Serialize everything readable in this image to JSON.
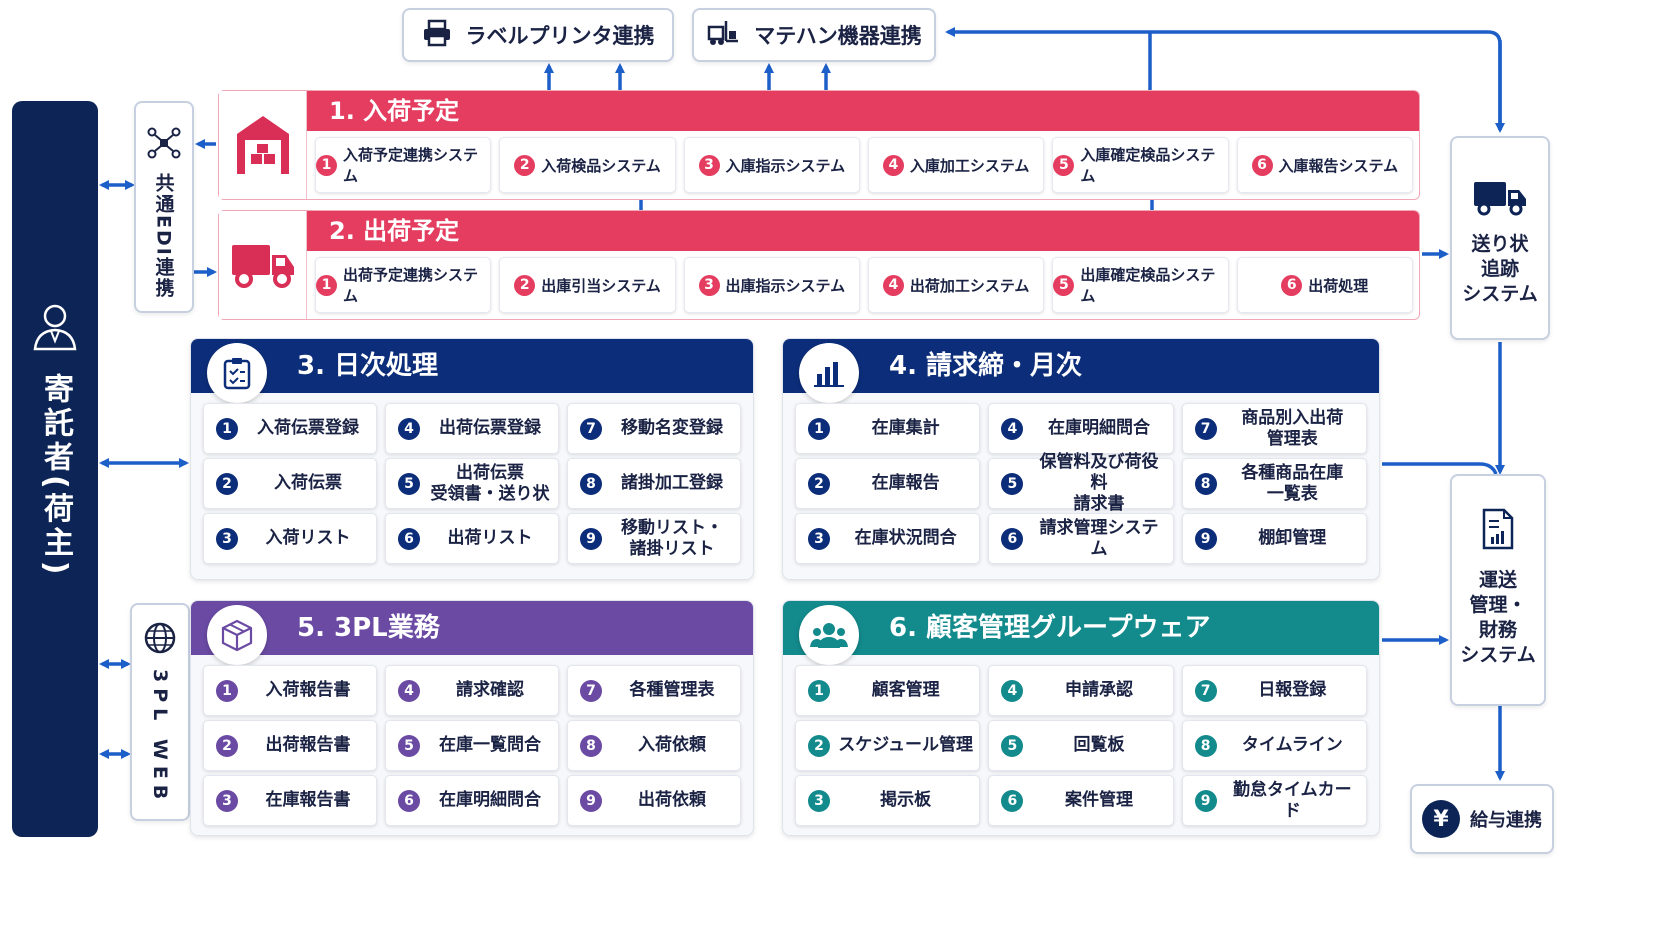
{
  "colors": {
    "navy": "#0c2556",
    "pink": "#e43d60",
    "arrow": "#1d5fc9",
    "violet": "#6a4aa3",
    "teal": "#138a8c"
  },
  "top": {
    "label_printer": "ラベルプリンタ連携",
    "matehan": "マテハン機器連携"
  },
  "left": {
    "shipper": "寄託者(荷主)",
    "edi": "共通EDI連携",
    "web": "3PL WEB"
  },
  "plans": [
    {
      "title": "1. 入荷予定",
      "icon": "warehouse-icon",
      "items": [
        {
          "num": "1",
          "label": "入荷予定連携システム"
        },
        {
          "num": "2",
          "label": "入荷検品システム"
        },
        {
          "num": "3",
          "label": "入庫指示システム"
        },
        {
          "num": "4",
          "label": "入庫加工システム"
        },
        {
          "num": "5",
          "label": "入庫確定検品システム"
        },
        {
          "num": "6",
          "label": "入庫報告システム"
        }
      ]
    },
    {
      "title": "2. 出荷予定",
      "icon": "truck-icon",
      "items": [
        {
          "num": "1",
          "label": "出荷予定連携システム"
        },
        {
          "num": "2",
          "label": "出庫引当システム"
        },
        {
          "num": "3",
          "label": "出庫指示システム"
        },
        {
          "num": "4",
          "label": "出荷加工システム"
        },
        {
          "num": "5",
          "label": "出庫確定検品システム"
        },
        {
          "num": "6",
          "label": "出荷処理"
        }
      ]
    }
  ],
  "sections": [
    {
      "title": "3. 日次処理",
      "icon": "clipboard-icon",
      "color": "#0c2d79",
      "items": [
        {
          "num": "1",
          "label": "入荷伝票登録"
        },
        {
          "num": "4",
          "label": "出荷伝票登録"
        },
        {
          "num": "7",
          "label": "移動名変登録"
        },
        {
          "num": "2",
          "label": "入荷伝票"
        },
        {
          "num": "5",
          "label": "出荷伝票\n受領書・送り状"
        },
        {
          "num": "8",
          "label": "諸掛加工登録"
        },
        {
          "num": "3",
          "label": "入荷リスト"
        },
        {
          "num": "6",
          "label": "出荷リスト"
        },
        {
          "num": "9",
          "label": "移動リスト・\n諸掛リスト"
        }
      ]
    },
    {
      "title": "4. 請求締・月次",
      "icon": "bar-chart-icon",
      "color": "#0c2d79",
      "items": [
        {
          "num": "1",
          "label": "在庫集計"
        },
        {
          "num": "4",
          "label": "在庫明細問合"
        },
        {
          "num": "7",
          "label": "商品別入出荷\n管理表"
        },
        {
          "num": "2",
          "label": "在庫報告"
        },
        {
          "num": "5",
          "label": "保管料及び荷役料\n請求書"
        },
        {
          "num": "8",
          "label": "各種商品在庫\n一覧表"
        },
        {
          "num": "3",
          "label": "在庫状況問合"
        },
        {
          "num": "6",
          "label": "請求管理システム"
        },
        {
          "num": "9",
          "label": "棚卸管理"
        }
      ]
    },
    {
      "title": "5. 3PL業務",
      "icon": "box-icon",
      "color": "#6a4aa3",
      "items": [
        {
          "num": "1",
          "label": "入荷報告書"
        },
        {
          "num": "4",
          "label": "請求確認"
        },
        {
          "num": "7",
          "label": "各種管理表"
        },
        {
          "num": "2",
          "label": "出荷報告書"
        },
        {
          "num": "5",
          "label": "在庫一覧問合"
        },
        {
          "num": "8",
          "label": "入荷依頼"
        },
        {
          "num": "3",
          "label": "在庫報告書"
        },
        {
          "num": "6",
          "label": "在庫明細問合"
        },
        {
          "num": "9",
          "label": "出荷依頼"
        }
      ]
    },
    {
      "title": "6. 顧客管理グループウェア",
      "icon": "users-icon",
      "color": "#138a8c",
      "items": [
        {
          "num": "1",
          "label": "顧客管理"
        },
        {
          "num": "4",
          "label": "申請承認"
        },
        {
          "num": "7",
          "label": "日報登録"
        },
        {
          "num": "2",
          "label": "スケジュール管理"
        },
        {
          "num": "5",
          "label": "回覧板"
        },
        {
          "num": "8",
          "label": "タイムライン"
        },
        {
          "num": "3",
          "label": "掲示板"
        },
        {
          "num": "6",
          "label": "案件管理"
        },
        {
          "num": "9",
          "label": "勤怠タイムカード"
        }
      ]
    }
  ],
  "right": {
    "tracking": "送り状\n追跡\nシステム",
    "finance": "運送\n管理・\n財務\nシステム",
    "payroll": "給与連携",
    "yen": "¥"
  }
}
